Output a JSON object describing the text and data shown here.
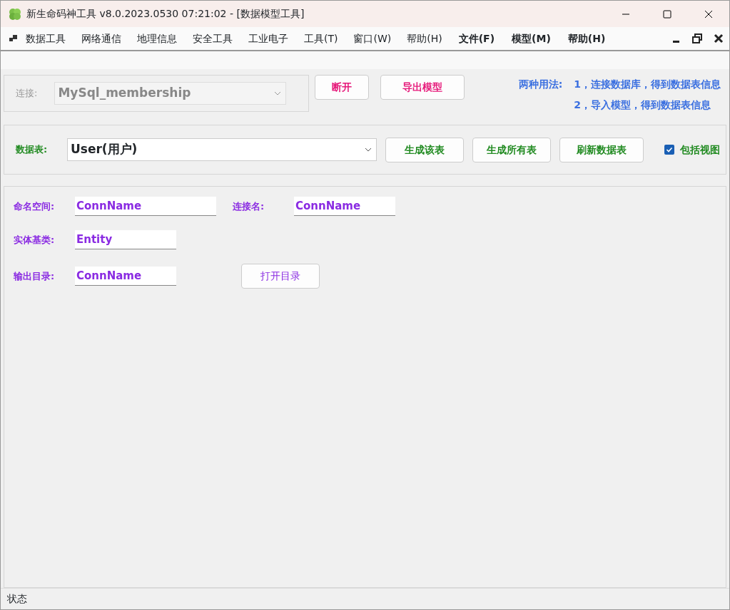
{
  "window": {
    "title": "新生命码神工具 v8.0.2023.0530 07:21:02 - [数据模型工具]"
  },
  "menu": [
    {
      "label": "数据工具",
      "kind": "app"
    },
    {
      "label": "网络通信",
      "kind": "app"
    },
    {
      "label": "地理信息",
      "kind": "app"
    },
    {
      "label": "安全工具",
      "kind": "app"
    },
    {
      "label": "工业电子",
      "kind": "app"
    },
    {
      "label": "工具(T)",
      "kind": "app"
    },
    {
      "label": "窗口(W)",
      "kind": "app"
    },
    {
      "label": "帮助(H)",
      "kind": "app"
    },
    {
      "label": "文件(F)",
      "kind": "child"
    },
    {
      "label": "模型(M)",
      "kind": "child"
    },
    {
      "label": "帮助(H)",
      "kind": "child"
    }
  ],
  "connection": {
    "label": "连接:",
    "value": "MySql_membership",
    "disabled": true,
    "buttons": [
      "断开",
      "导出模型"
    ]
  },
  "usage": {
    "title": "两种用法:",
    "lines": [
      "1，连接数据库，得到数据表信息",
      "2，导入模型，得到数据表信息"
    ]
  },
  "table_select": {
    "label": "数据表:",
    "value": "User(用户)",
    "buttons": [
      "生成该表",
      "生成所有表",
      "刷新数据表"
    ],
    "checkbox": {
      "label": "包括视图",
      "checked": true
    }
  },
  "form": {
    "fields": [
      {
        "label": "命名空间:",
        "value": "ConnName"
      },
      {
        "label": "连接名:",
        "value": "ConnName"
      },
      {
        "label": "实体基类:",
        "value": "Entity"
      },
      {
        "label": "输出目录:",
        "value": "ConnName"
      }
    ],
    "button": "打开目录"
  },
  "status_bar": "状态"
}
